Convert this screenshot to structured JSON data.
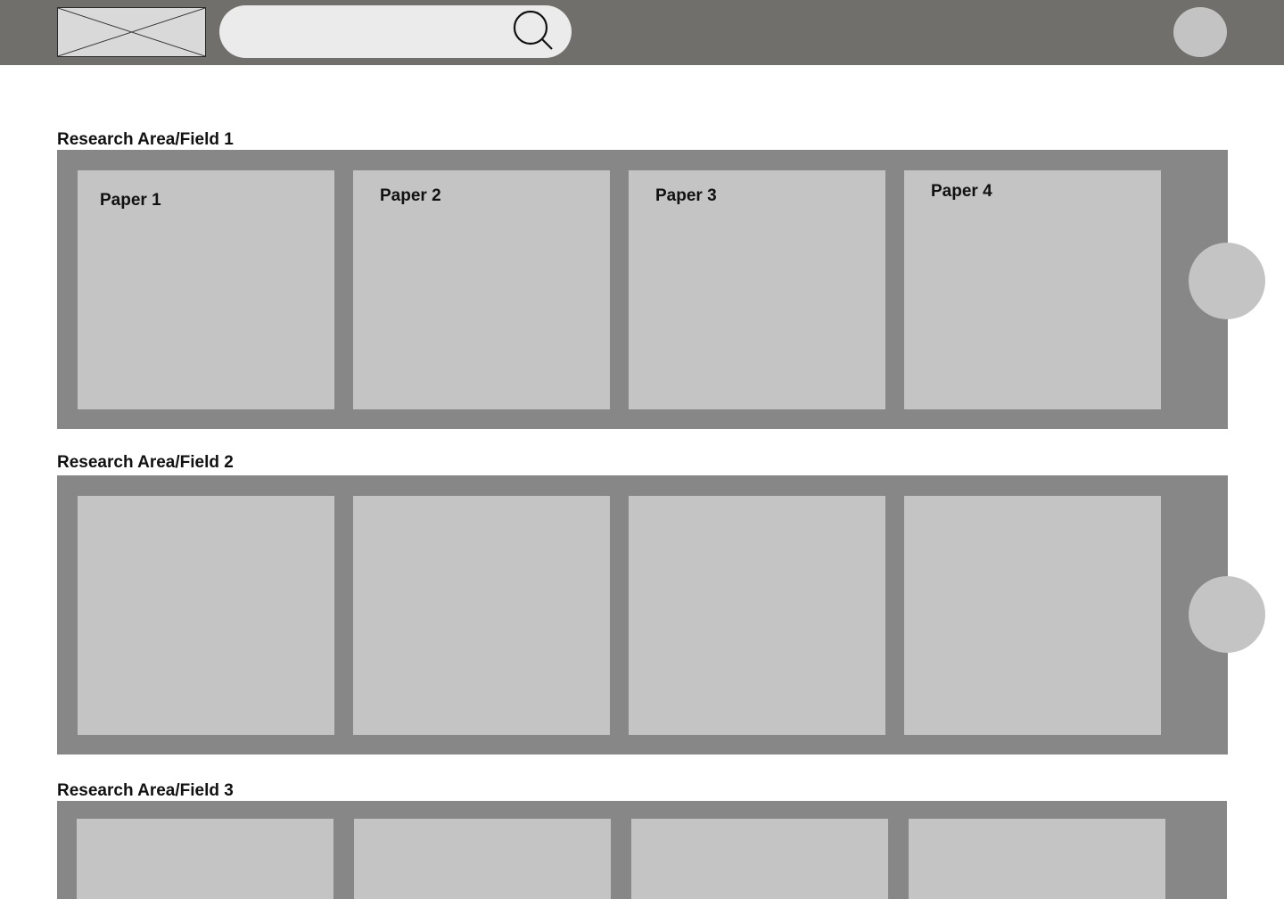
{
  "header": {
    "logo_alt": "logo placeholder",
    "search": {
      "value": "",
      "placeholder": ""
    }
  },
  "sections": [
    {
      "title": "Research Area/Field 1",
      "papers": [
        "Paper 1",
        "Paper 2",
        "Paper 3",
        "Paper 4"
      ]
    },
    {
      "title": "Research Area/Field 2",
      "papers": [
        "",
        "",
        "",
        ""
      ]
    },
    {
      "title": "Research Area/Field 3",
      "papers": [
        "",
        "",
        "",
        ""
      ]
    }
  ],
  "icons": {
    "search": "search-icon",
    "logo": "image-placeholder-icon",
    "avatar": "avatar",
    "next": "next-arrow-button"
  },
  "colors": {
    "topbar": "#706f6c",
    "panel": "#878787",
    "card": "#c4c4c4",
    "search_bg": "#ebebeb"
  }
}
